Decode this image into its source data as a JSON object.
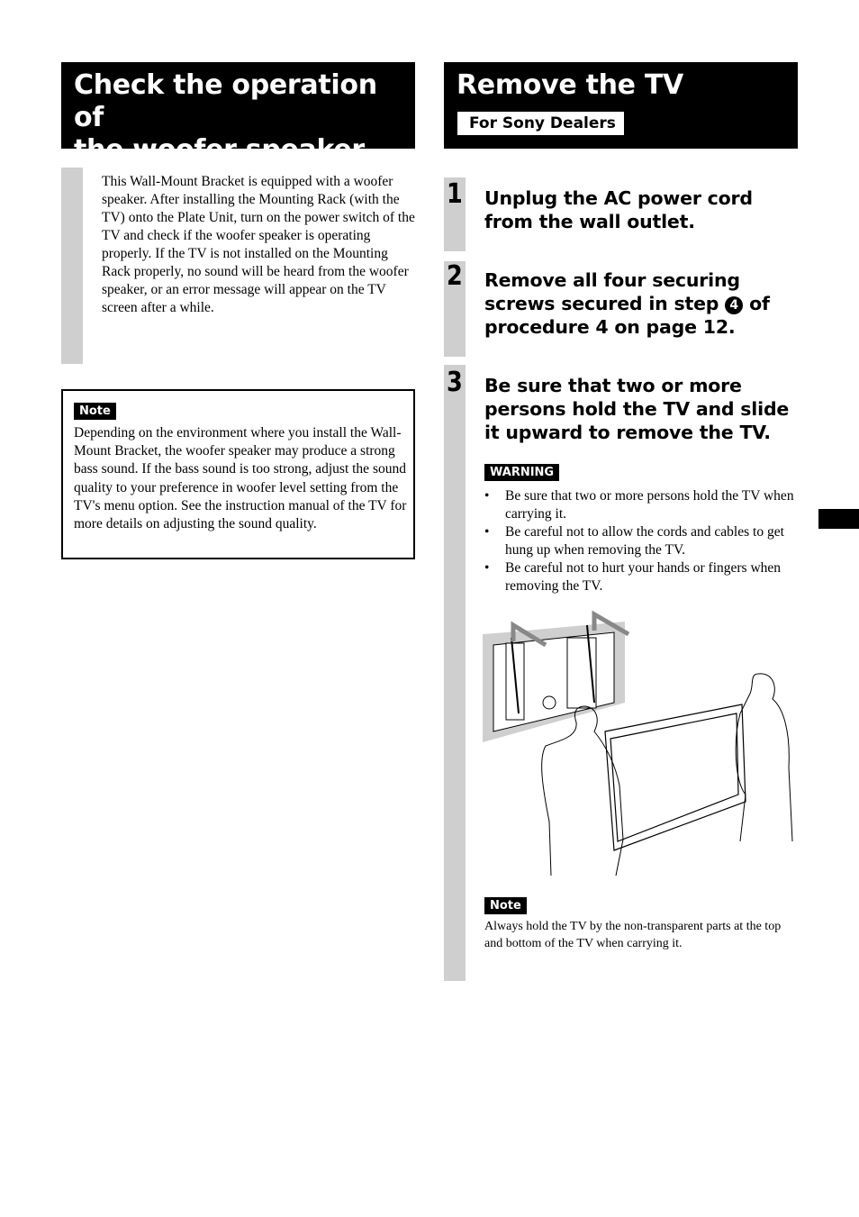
{
  "left_section": {
    "title_line1": "Check the operation of",
    "title_line2": "the woofer speaker",
    "intro": "This Wall-Mount Bracket is equipped with a woofer speaker. After installing the Mounting Rack (with the TV) onto the Plate Unit, turn on the power switch of the TV and check if the woofer speaker is operating properly. If the TV is not installed on the Mounting Rack properly, no sound will be heard from the woofer speaker, or an error message will appear on the TV screen after a while.",
    "note": {
      "label": "Note",
      "text": "Depending on the environment where you install the Wall-Mount Bracket, the woofer speaker may produce a strong bass sound. If the bass sound is too strong, adjust the sound quality to your preference in woofer level setting from the TV's menu option. See the instruction manual of the TV for more details on adjusting the sound quality."
    }
  },
  "right_section": {
    "title": "Remove the TV",
    "badge": "For Sony Dealers",
    "steps": [
      {
        "number": "1",
        "text": "Unplug the AC power cord from the wall outlet."
      },
      {
        "number": "2",
        "text_before": "Remove all four securing screws secured in step ",
        "circled": "4",
        "text_after": " of procedure 4 on page 12."
      },
      {
        "number": "3",
        "text": "Be sure that two or more persons hold the TV and slide it upward to remove the TV."
      }
    ],
    "warning": {
      "label": "WARNING",
      "items": [
        "Be sure that two or more persons hold the TV when carrying it.",
        "Be careful not to allow the cords and cables to get hung up when removing the TV.",
        "Be careful not to hurt your hands or fingers when removing the TV."
      ]
    },
    "illustration": {
      "alt": "Two persons lifting the TV upward off the wall-mount bracket"
    },
    "note": {
      "label": "Note",
      "text": "Always hold the TV by the non-transparent parts at the top and bottom of the TV when carrying it."
    }
  }
}
